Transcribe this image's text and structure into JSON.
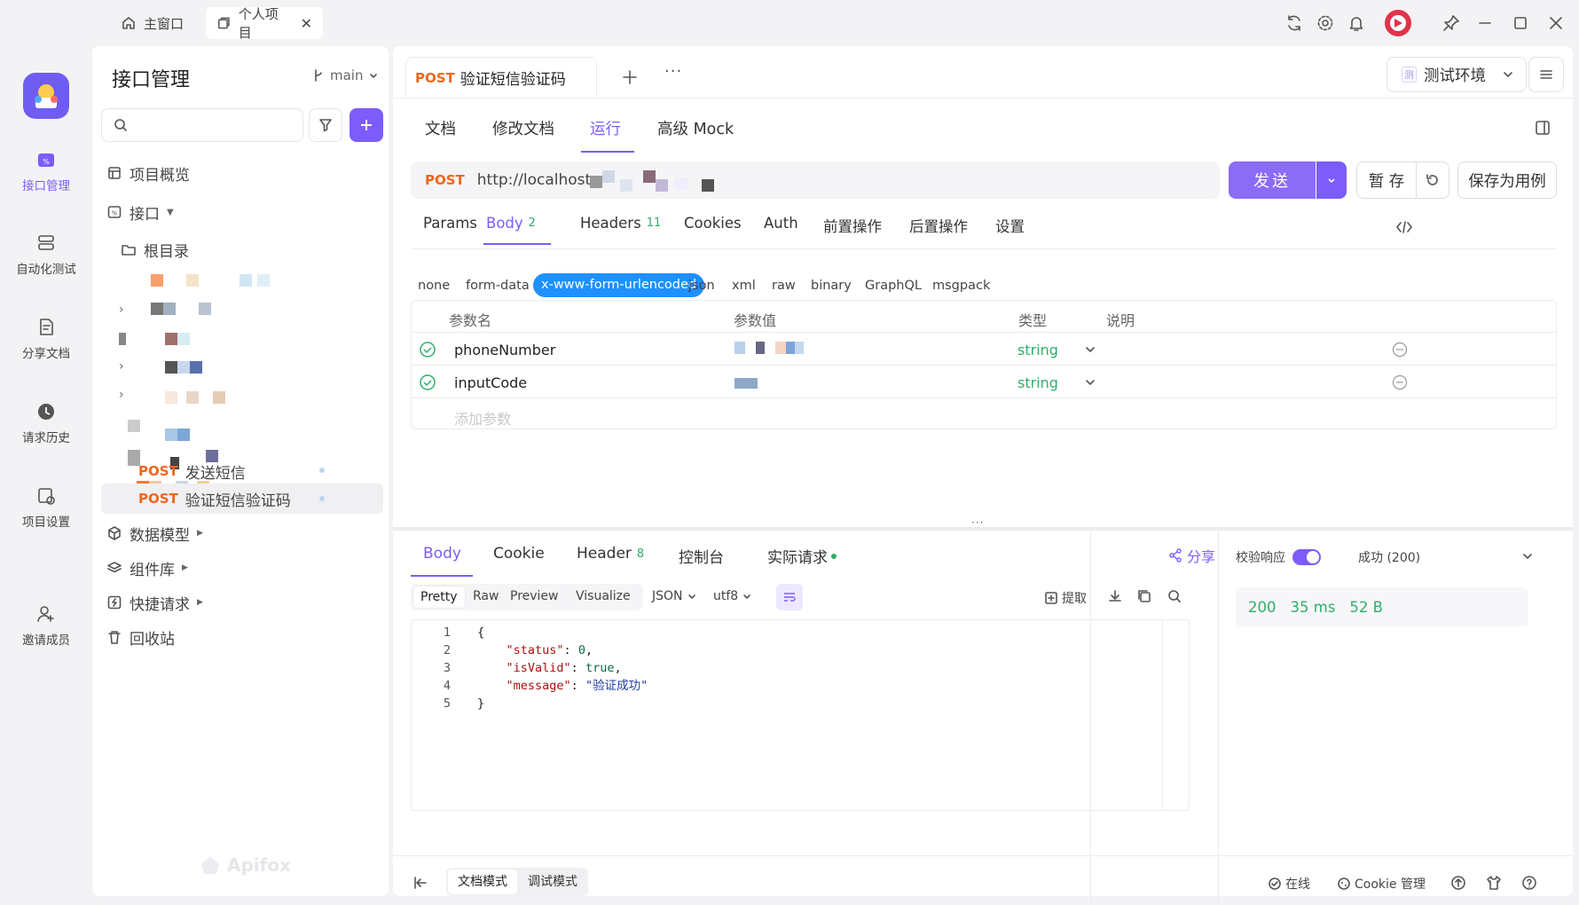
{
  "window": {
    "tabs": [
      {
        "label": "主窗口",
        "icon": "home-icon"
      },
      {
        "label": "个人项目",
        "icon": "window-icon"
      }
    ]
  },
  "rail": {
    "items": [
      {
        "label": "接口管理",
        "icon": "api-icon",
        "active": true
      },
      {
        "label": "自动化测试",
        "icon": "automation-icon"
      },
      {
        "label": "分享文档",
        "icon": "share-doc-icon"
      },
      {
        "label": "请求历史",
        "icon": "history-icon"
      },
      {
        "label": "项目设置",
        "icon": "project-settings-icon"
      },
      {
        "label": "邀请成员",
        "icon": "invite-member-icon"
      }
    ]
  },
  "sidebar": {
    "title": "接口管理",
    "branch": "main",
    "search_placeholder": "",
    "overview": "项目概览",
    "api": "接口",
    "root": "根目录",
    "requests": [
      {
        "method": "POST",
        "name": "发送短信"
      },
      {
        "method": "POST",
        "name": "验证短信验证码"
      }
    ],
    "data_model": "数据模型",
    "components": "组件库",
    "quick_requests": "快捷请求",
    "recycle": "回收站",
    "watermark": "Apifox"
  },
  "main": {
    "request_tab": {
      "method": "POST",
      "name": "验证短信验证码"
    },
    "environment": {
      "badge": "测",
      "label": "测试环境"
    },
    "view_tabs": [
      "文档",
      "修改文档",
      "运行",
      "高级 Mock"
    ],
    "active_view_tab": "运行",
    "url": {
      "method": "POST",
      "value": "http://localhost:"
    },
    "send": "发送",
    "save_temp": "暂 存",
    "save_case": "保存为用例",
    "req_tabs": [
      {
        "label": "Params",
        "count": ""
      },
      {
        "label": "Body",
        "count": "2"
      },
      {
        "label": "Headers",
        "count": "11"
      },
      {
        "label": "Cookies",
        "count": ""
      },
      {
        "label": "Auth",
        "count": ""
      },
      {
        "label": "前置操作",
        "count": ""
      },
      {
        "label": "后置操作",
        "count": ""
      },
      {
        "label": "设置",
        "count": ""
      }
    ],
    "body_types": [
      "none",
      "form-data",
      "x-www-form-urlencoded",
      "json",
      "xml",
      "raw",
      "binary",
      "GraphQL",
      "msgpack"
    ],
    "active_body_type": "x-www-form-urlencoded",
    "params_headers": [
      "参数名",
      "参数值",
      "类型",
      "说明"
    ],
    "params": [
      {
        "name": "phoneNumber",
        "type": "string"
      },
      {
        "name": "inputCode",
        "type": "string"
      }
    ],
    "add_param_placeholder": "添加参数"
  },
  "response": {
    "tabs": [
      {
        "label": "Body",
        "count": ""
      },
      {
        "label": "Cookie",
        "count": ""
      },
      {
        "label": "Header",
        "count": "8"
      },
      {
        "label": "控制台",
        "count": ""
      },
      {
        "label": "实际请求",
        "count": ""
      }
    ],
    "share": "分享",
    "formats": [
      "Pretty",
      "Raw",
      "Preview",
      "Visualize"
    ],
    "lang": "JSON",
    "encoding": "utf8",
    "extract": "提取",
    "code_lines": [
      {
        "n": "1",
        "indent": "",
        "key": "",
        "sep": "",
        "val": "",
        "tail": "{"
      },
      {
        "n": "2",
        "indent": "    ",
        "key": "\"status\"",
        "sep": ": ",
        "val": "0",
        "tail": ","
      },
      {
        "n": "3",
        "indent": "    ",
        "key": "\"isValid\"",
        "sep": ": ",
        "val": "true",
        "tail": ","
      },
      {
        "n": "4",
        "indent": "    ",
        "key": "\"message\"",
        "sep": ": ",
        "val": "\"验证成功\"",
        "tail": ""
      },
      {
        "n": "5",
        "indent": "",
        "key": "",
        "sep": "",
        "val": "",
        "tail": "}"
      }
    ],
    "validate_label": "校验响应",
    "validate_status": "成功 (200)",
    "status_code": "200",
    "time": "35 ms",
    "size": "52 B"
  },
  "footer": {
    "doc_mode": "文档模式",
    "debug_mode": "调试模式",
    "online": "在线",
    "cookie_mgmt": "Cookie 管理"
  },
  "colors": {
    "accent": "#7c5cfa",
    "post": "#f0661d",
    "success": "#2fae6b"
  }
}
